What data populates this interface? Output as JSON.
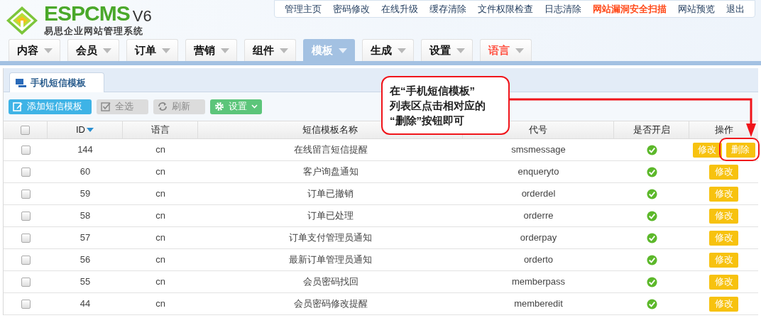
{
  "logo": {
    "brand": "ESPCMS",
    "version": "V6",
    "subtitle": "易思企业网站管理系统"
  },
  "top_links": [
    {
      "label": "管理主页",
      "highlight": false
    },
    {
      "label": "密码修改",
      "highlight": false
    },
    {
      "label": "在线升级",
      "highlight": false
    },
    {
      "label": "缓存清除",
      "highlight": false
    },
    {
      "label": "文件权限检查",
      "highlight": false
    },
    {
      "label": "日志清除",
      "highlight": false
    },
    {
      "label": "网站漏洞安全扫描",
      "highlight": true
    },
    {
      "label": "网站预览",
      "highlight": false
    },
    {
      "label": "退出",
      "highlight": false
    }
  ],
  "menu": [
    {
      "label": "内容",
      "selected": false,
      "highlight": false
    },
    {
      "label": "会员",
      "selected": false,
      "highlight": false
    },
    {
      "label": "订单",
      "selected": false,
      "highlight": false
    },
    {
      "label": "营销",
      "selected": false,
      "highlight": false
    },
    {
      "label": "组件",
      "selected": false,
      "highlight": false
    },
    {
      "label": "模板",
      "selected": true,
      "highlight": false
    },
    {
      "label": "生成",
      "selected": false,
      "highlight": false
    },
    {
      "label": "设置",
      "selected": false,
      "highlight": false
    },
    {
      "label": "语言",
      "selected": false,
      "highlight": true
    }
  ],
  "page_tab": {
    "label": "手机短信模板"
  },
  "toolbar": [
    {
      "kind": "add",
      "label": "添加短信模板"
    },
    {
      "kind": "select",
      "label": "全选"
    },
    {
      "kind": "refresh",
      "label": "刷新"
    },
    {
      "kind": "settings",
      "label": "设置"
    }
  ],
  "table": {
    "all_checked": false,
    "columns": [
      "ID",
      "语言",
      "短信模板名称",
      "代号",
      "是否开启",
      "操作"
    ],
    "rows": [
      {
        "checked": false,
        "id": "144",
        "lang": "cn",
        "name": "在线留言短信提醒",
        "code": "smsmessage",
        "enabled": true,
        "actions": [
          "修改",
          "删除"
        ]
      },
      {
        "checked": false,
        "id": "60",
        "lang": "cn",
        "name": "客户询盘通知",
        "code": "enqueryto",
        "enabled": true,
        "actions": [
          "修改"
        ]
      },
      {
        "checked": false,
        "id": "59",
        "lang": "cn",
        "name": "订单已撤销",
        "code": "orderdel",
        "enabled": true,
        "actions": [
          "修改"
        ]
      },
      {
        "checked": false,
        "id": "58",
        "lang": "cn",
        "name": "订单已处理",
        "code": "orderre",
        "enabled": true,
        "actions": [
          "修改"
        ]
      },
      {
        "checked": false,
        "id": "57",
        "lang": "cn",
        "name": "订单支付管理员通知",
        "code": "orderpay",
        "enabled": true,
        "actions": [
          "修改"
        ]
      },
      {
        "checked": false,
        "id": "56",
        "lang": "cn",
        "name": "最新订单管理员通知",
        "code": "orderto",
        "enabled": true,
        "actions": [
          "修改"
        ]
      },
      {
        "checked": false,
        "id": "55",
        "lang": "cn",
        "name": "会员密码找回",
        "code": "memberpass",
        "enabled": true,
        "actions": [
          "修改"
        ]
      },
      {
        "checked": false,
        "id": "44",
        "lang": "cn",
        "name": "会员密码修改提醒",
        "code": "memberedit",
        "enabled": true,
        "actions": [
          "修改"
        ]
      }
    ]
  },
  "callout": {
    "lines": [
      "在“手机短信模板”",
      "列表区点击相对应的",
      "“删除”按钮即可"
    ]
  }
}
